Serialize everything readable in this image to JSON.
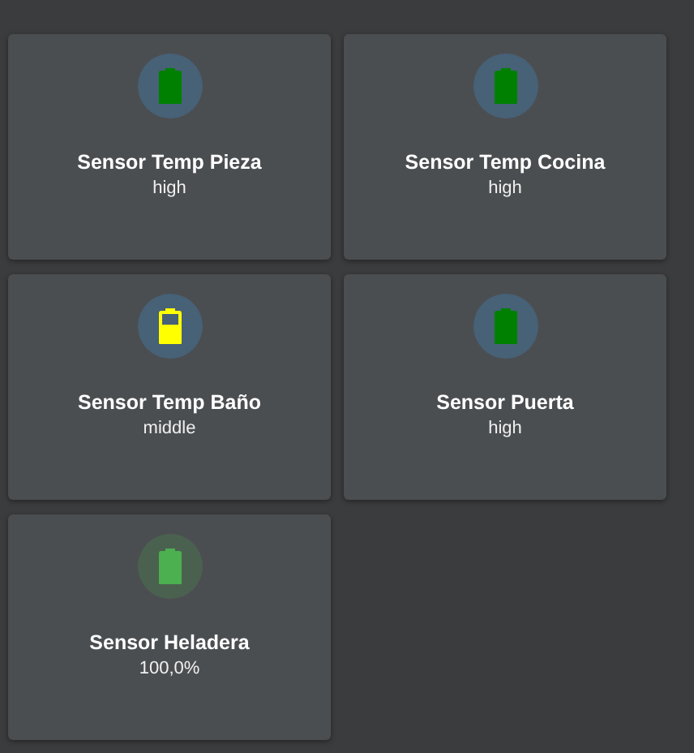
{
  "cards": [
    {
      "kind": "status",
      "name": "Sensor Temp Pieza",
      "state": "high",
      "color": "#008000",
      "partial": false
    },
    {
      "kind": "status",
      "name": "Sensor Temp Cocina",
      "state": "high",
      "color": "#008000",
      "partial": false
    },
    {
      "kind": "status",
      "name": "Sensor Temp Baño",
      "state": "middle",
      "color": "#ffff00",
      "partial": true
    },
    {
      "kind": "status",
      "name": "Sensor Puerta",
      "state": "high",
      "color": "#008000",
      "partial": false
    },
    {
      "kind": "percent",
      "name": "Sensor Heladera",
      "state": "100,0%",
      "color": "#4caf50",
      "partial": false
    }
  ]
}
